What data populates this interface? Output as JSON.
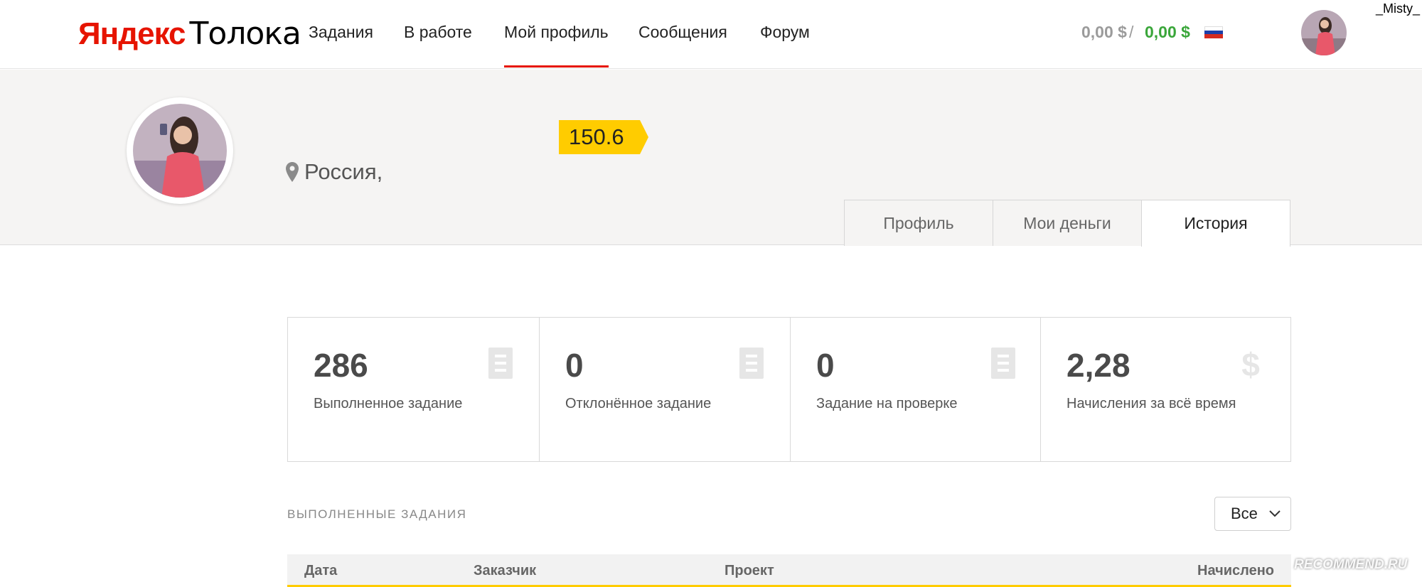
{
  "header": {
    "logo_brand": "Яндекс",
    "logo_product": "Толока",
    "nav": [
      {
        "label": "Задания"
      },
      {
        "label": "В работе"
      },
      {
        "label": "Мой профиль"
      },
      {
        "label": "Сообщения"
      },
      {
        "label": "Форум"
      }
    ],
    "active_nav": "Мой профиль",
    "balance_pending": "0,00 $",
    "balance_sep": "/",
    "balance_available": "0,00 $",
    "language_flag": "russia-flag-icon",
    "username": "_Misty_"
  },
  "profile": {
    "rating": "150.6",
    "location": "Россия,",
    "tabs": [
      {
        "label": "Профиль"
      },
      {
        "label": "Мои деньги"
      },
      {
        "label": "История"
      }
    ],
    "active_tab": "История"
  },
  "stats": [
    {
      "value": "286",
      "label": "Выполненное задание",
      "icon": "document-icon"
    },
    {
      "value": "0",
      "label": "Отклонённое задание",
      "icon": "document-icon"
    },
    {
      "value": "0",
      "label": "Задание на проверке",
      "icon": "document-icon"
    },
    {
      "value": "2,28",
      "label": "Начисления за всё время",
      "icon": "dollar-icon"
    }
  ],
  "section": {
    "title": "ВЫПОЛНЕННЫЕ ЗАДАНИЯ",
    "filter_value": "Все"
  },
  "table": {
    "columns": [
      "Дата",
      "Заказчик",
      "Проект",
      "Начислено"
    ]
  },
  "watermark": "RECOMMEND.RU",
  "colors": {
    "brand_red": "#e61400",
    "rating_yellow": "#ffcc00",
    "balance_green": "#3aa63a",
    "band_bg": "#f5f4f3"
  }
}
